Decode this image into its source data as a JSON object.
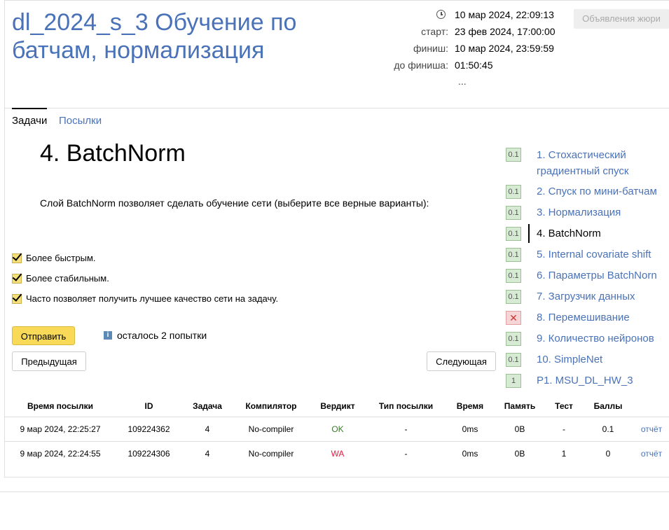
{
  "contest": {
    "title": "dl_2024_s_3 Обучение по батчам, нормализация",
    "now": "10 мар 2024, 22:09:13",
    "start_label": "старт:",
    "start": "23 фев 2024, 17:00:00",
    "finish_label": "финиш:",
    "finish": "10 мар 2024, 23:59:59",
    "left_label": "до финиша:",
    "left": "01:50:45",
    "more": "...",
    "jury_button": "Объявления жюри"
  },
  "tabs": {
    "tasks": "Задачи",
    "submissions": "Посылки"
  },
  "problem": {
    "title": "4. BatchNorm",
    "statement": "Слой BatchNorm позволяет сделать обучение сети (выберите все верные варианты):",
    "options": [
      {
        "label": "Более быстрым.",
        "checked": true
      },
      {
        "label": "Более стабильным.",
        "checked": true
      },
      {
        "label": "Часто позволяет получить лучшее качество сети на задачу.",
        "checked": true
      }
    ],
    "submit": "Отправить",
    "attempts": "осталось 2 попытки",
    "info_glyph": "i",
    "prev": "Предыдущая",
    "next": "Следующая"
  },
  "sidebar": [
    {
      "badge": "0.1",
      "label": "1. Стохастический градиентный спуск",
      "status": "ok"
    },
    {
      "badge": "0.1",
      "label": "2. Спуск по мини-батчам",
      "status": "ok"
    },
    {
      "badge": "0.1",
      "label": "3. Нормализация",
      "status": "ok"
    },
    {
      "badge": "0.1",
      "label": "4. BatchNorm",
      "status": "ok",
      "active": true
    },
    {
      "badge": "0.1",
      "label": "5. Internal covariate shift",
      "status": "ok"
    },
    {
      "badge": "0.1",
      "label": "6. Параметры BatchNorn",
      "status": "ok"
    },
    {
      "badge": "0.1",
      "label": "7. Загрузчик данных",
      "status": "ok"
    },
    {
      "badge": "✕",
      "label": "8. Перемешивание",
      "status": "fail"
    },
    {
      "badge": "0.1",
      "label": "9. Количество нейронов",
      "status": "ok"
    },
    {
      "badge": "0.1",
      "label": "10. SimpleNet",
      "status": "ok"
    },
    {
      "badge": "1",
      "label": "P1. MSU_DL_HW_3",
      "status": "ok"
    }
  ],
  "submissions": {
    "headers": [
      "Время посылки",
      "ID",
      "Задача",
      "Компилятор",
      "Вердикт",
      "Тип посылки",
      "Время",
      "Память",
      "Тест",
      "Баллы",
      ""
    ],
    "rows": [
      [
        "9 мар 2024, 22:25:27",
        "109224362",
        "4",
        "No-compiler",
        "OK",
        "-",
        "0ms",
        "0B",
        "-",
        "0.1",
        "отчёт"
      ],
      [
        "9 мар 2024, 22:24:55",
        "109224306",
        "4",
        "No-compiler",
        "WA",
        "-",
        "0ms",
        "0B",
        "1",
        "0",
        "отчёт"
      ]
    ]
  },
  "colors": {
    "link": "#4a72b8",
    "ok": "#3a7a2a",
    "wa": "#dd2244",
    "submit": "#f8d958"
  }
}
